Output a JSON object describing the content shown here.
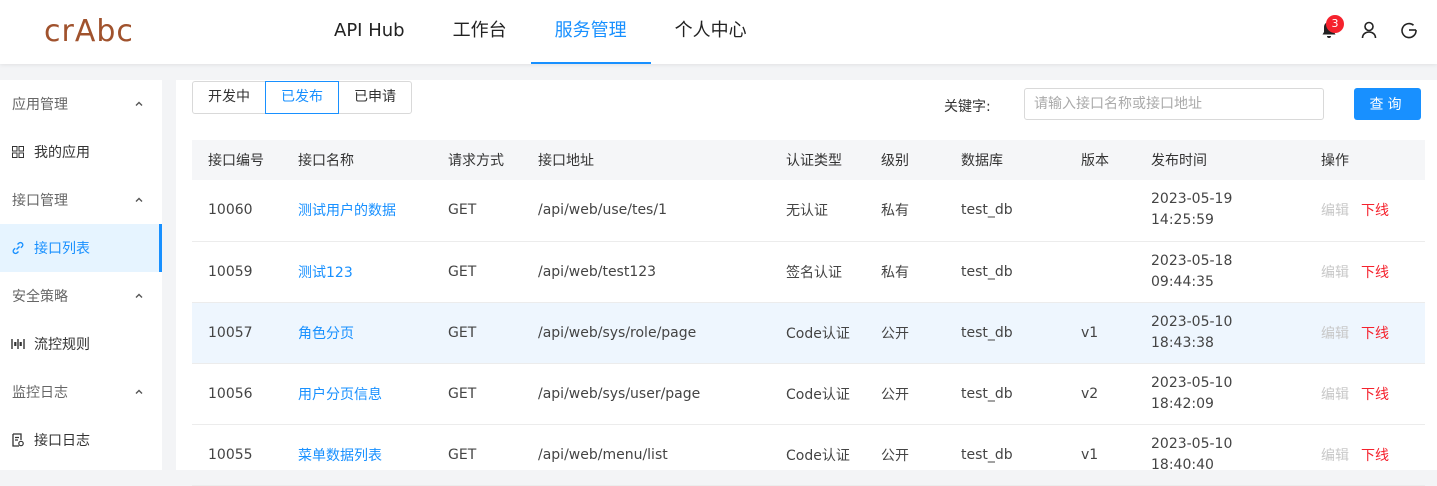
{
  "logo": "crAbc",
  "nav": [
    "API Hub",
    "工作台",
    "服务管理",
    "个人中心"
  ],
  "header": {
    "notification_count": "3"
  },
  "sidebar": {
    "groups": [
      {
        "label": "应用管理",
        "items": [
          {
            "label": "我的应用",
            "icon": "grid-icon"
          }
        ]
      },
      {
        "label": "接口管理",
        "items": [
          {
            "label": "接口列表",
            "icon": "link-icon"
          }
        ]
      },
      {
        "label": "安全策略",
        "items": [
          {
            "label": "流控规则",
            "icon": "flow-control-icon"
          }
        ]
      },
      {
        "label": "监控日志",
        "items": [
          {
            "label": "接口日志",
            "icon": "log-icon"
          }
        ]
      }
    ]
  },
  "tabs": [
    "开发中",
    "已发布",
    "已申请"
  ],
  "search": {
    "label": "关键字:",
    "placeholder": "请输入接口名称或接口地址",
    "button": "查询"
  },
  "table": {
    "headers": [
      "接口编号",
      "接口名称",
      "请求方式",
      "接口地址",
      "认证类型",
      "级别",
      "数据库",
      "版本",
      "发布时间",
      "操作"
    ],
    "rows": [
      {
        "id": "10060",
        "name": "测试用户的数据",
        "method": "GET",
        "path": "/api/web/use/tes/1",
        "auth": "无认证",
        "level": "私有",
        "db": "test_db",
        "version": "",
        "date": "2023-05-19",
        "time": "14:25:59",
        "edit": "编辑",
        "offline": "下线"
      },
      {
        "id": "10059",
        "name": "测试123",
        "method": "GET",
        "path": "/api/web/test123",
        "auth": "签名认证",
        "level": "私有",
        "db": "test_db",
        "version": "",
        "date": "2023-05-18",
        "time": "09:44:35",
        "edit": "编辑",
        "offline": "下线"
      },
      {
        "id": "10057",
        "name": "角色分页",
        "method": "GET",
        "path": "/api/web/sys/role/page",
        "auth": "Code认证",
        "level": "公开",
        "db": "test_db",
        "version": "v1",
        "date": "2023-05-10",
        "time": "18:43:38",
        "edit": "编辑",
        "offline": "下线"
      },
      {
        "id": "10056",
        "name": "用户分页信息",
        "method": "GET",
        "path": "/api/web/sys/user/page",
        "auth": "Code认证",
        "level": "公开",
        "db": "test_db",
        "version": "v2",
        "date": "2023-05-10",
        "time": "18:42:09",
        "edit": "编辑",
        "offline": "下线"
      },
      {
        "id": "10055",
        "name": "菜单数据列表",
        "method": "GET",
        "path": "/api/web/menu/list",
        "auth": "Code认证",
        "level": "公开",
        "db": "test_db",
        "version": "v1",
        "date": "2023-05-10",
        "time": "18:40:40",
        "edit": "编辑",
        "offline": "下线"
      }
    ]
  },
  "colors": {
    "primary": "#1890ff",
    "danger": "#f5222d",
    "logo": "#a0522d",
    "highlight_row": "#eef6fe"
  }
}
